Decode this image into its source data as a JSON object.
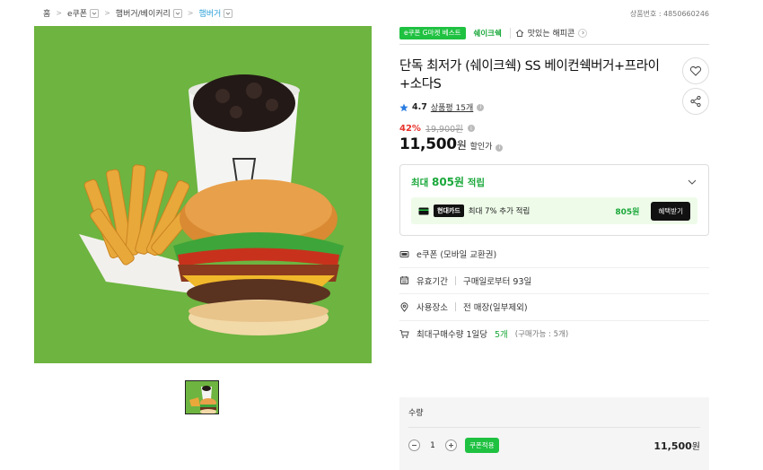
{
  "breadcrumb": [
    {
      "label": "홈"
    },
    {
      "label": "e쿠폰"
    },
    {
      "label": "햄버거/베이커리"
    },
    {
      "label": "햄버거"
    }
  ],
  "product_id": "상품번호 : 4850660246",
  "tags": {
    "best": "e쿠폰 G마켓 베스트",
    "brand": "쉐이크쉑",
    "store": "맛있는 해피콘"
  },
  "title": "단독 최저가 (쉐이크쉑) SS 베이컨쉑버거+프라이+소다S",
  "rating": {
    "score": "4.7",
    "reviews": "상품평 15개"
  },
  "price": {
    "discount": "42%",
    "original": "19,900원",
    "current": "11,500",
    "unit": "원",
    "label": "할인가"
  },
  "reward": {
    "prefix": "최대",
    "amount": "805원",
    "suffix": "적립",
    "card_name": "현대카드",
    "card_text": "최대 7% 추가 적립",
    "card_amount": "805원",
    "card_button": "혜택받기"
  },
  "info": [
    {
      "icon": "coupon-icon",
      "text": "e쿠폰 (모바일 교환권)"
    },
    {
      "icon": "calendar-icon",
      "label": "유효기간",
      "value": "구매일로부터 93일"
    },
    {
      "icon": "location-icon",
      "label": "사용장소",
      "value": "전 매장(일부제외)"
    },
    {
      "icon": "cart-icon",
      "text": "최대구매수량 1일당",
      "highlight": "5개",
      "note": "(구매가능 : 5개)"
    }
  ],
  "quantity": {
    "label": "수량",
    "value": "1",
    "coupon_button": "쿠폰적용",
    "total": "11,500",
    "total_unit": "원"
  },
  "colors": {
    "accent": "#1fc141",
    "discount": "#e8322c",
    "image_bg": "#6db440"
  }
}
